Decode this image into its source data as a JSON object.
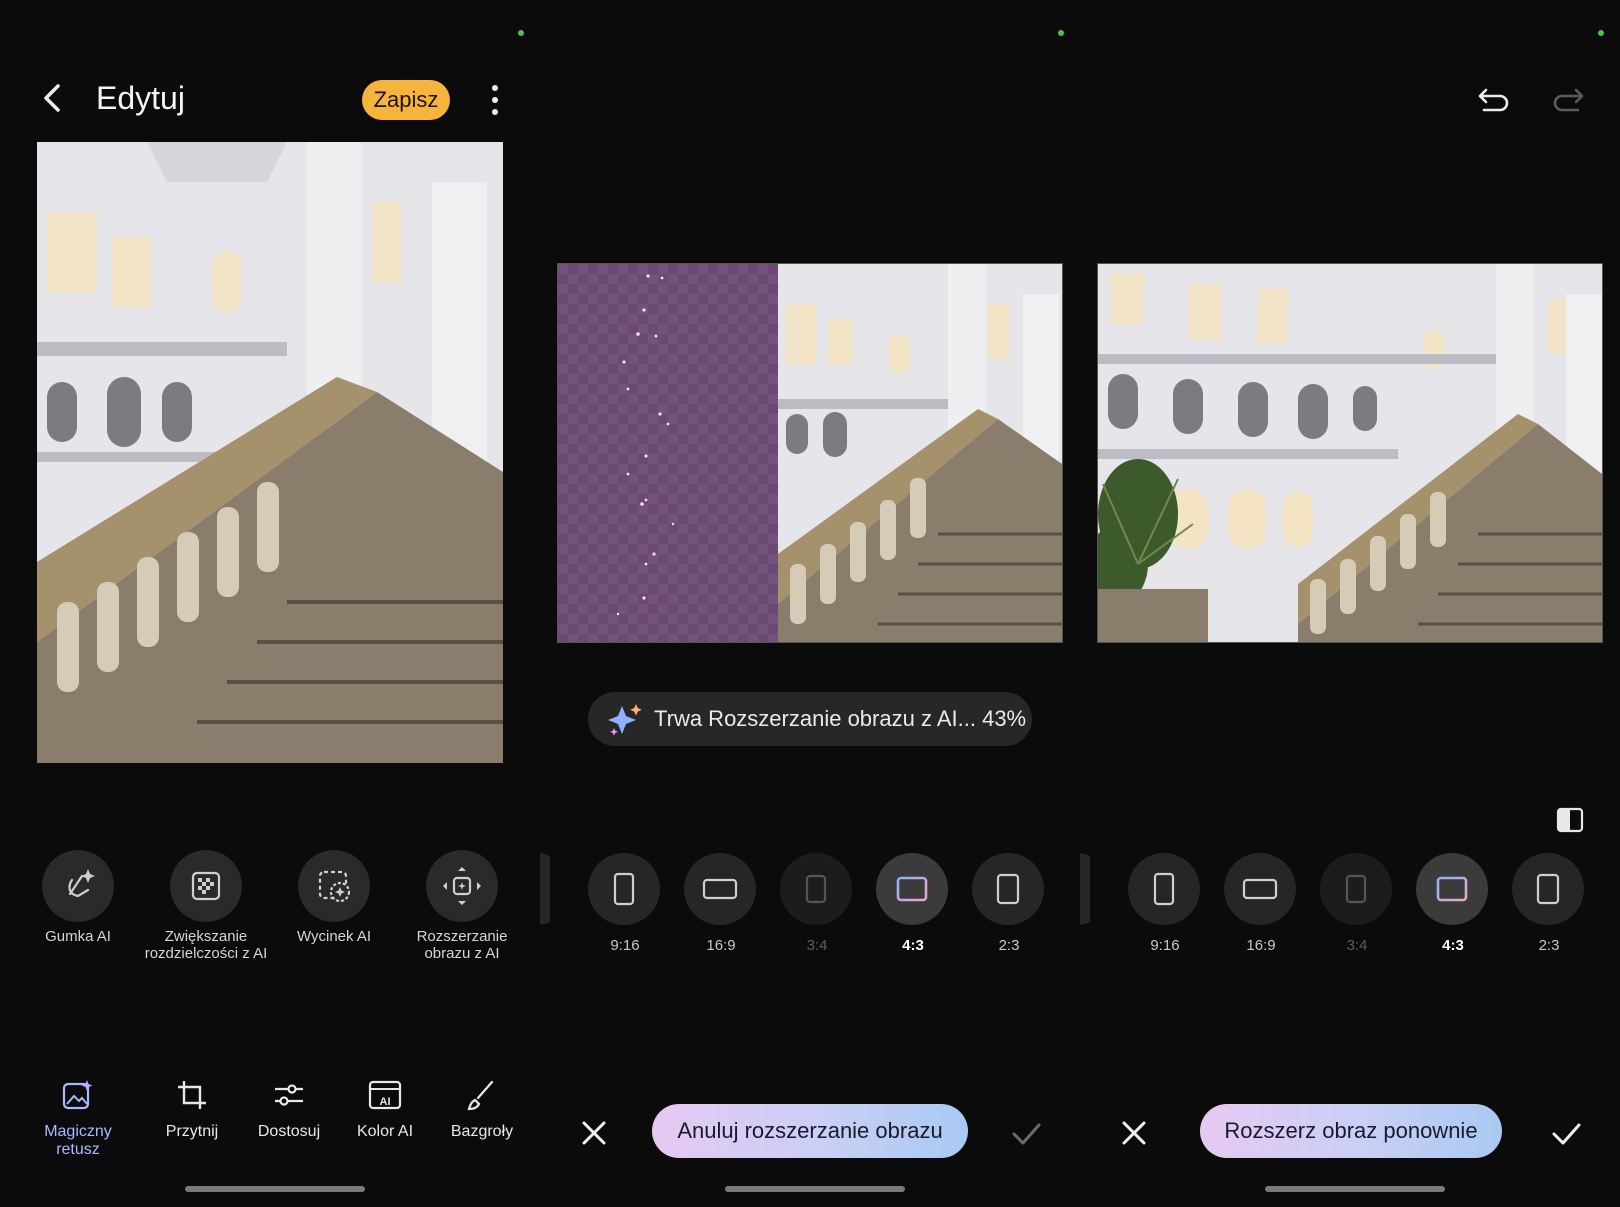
{
  "panel1": {
    "header": {
      "title": "Edytuj",
      "save_label": "Zapisz"
    },
    "tools": [
      {
        "label": "Gumka AI",
        "icon": "ai-eraser-icon"
      },
      {
        "label": "Zwiększanie rozdzielczości z AI",
        "icon": "ai-upscale-icon"
      },
      {
        "label": "Wycinek AI",
        "icon": "ai-cutout-icon"
      },
      {
        "label": "Rozszerzanie obrazu z AI",
        "icon": "ai-expand-icon"
      }
    ],
    "bottom_nav": [
      {
        "label": "Magiczny retusz",
        "icon": "magic-retouch-icon",
        "active": true
      },
      {
        "label": "Przytnij",
        "icon": "crop-icon",
        "active": false
      },
      {
        "label": "Dostosuj",
        "icon": "adjust-sliders-icon",
        "active": false
      },
      {
        "label": "Kolor AI",
        "icon": "ai-color-icon",
        "active": false
      },
      {
        "label": "Bazgroły",
        "icon": "brush-icon",
        "active": false
      }
    ]
  },
  "panel2": {
    "progress_text": "Trwa Rozszerzanie obrazu z AI... 43%",
    "progress_value": 0.43,
    "cancel_label": "Anuluj rozszerzanie obrazu"
  },
  "panel3": {
    "redo_label": "Rozszerz obraz ponownie"
  },
  "ratios": [
    {
      "label": "9:16",
      "state": "normal"
    },
    {
      "label": "16:9",
      "state": "normal"
    },
    {
      "label": "3:4",
      "state": "disabled"
    },
    {
      "label": "4:3",
      "state": "selected"
    },
    {
      "label": "2:3",
      "state": "normal"
    }
  ],
  "colors": {
    "save": "#f6b43c",
    "accent": "#a9b8ff",
    "expand_overlay": "#6a4a72",
    "status_dot": "#49c24a"
  }
}
